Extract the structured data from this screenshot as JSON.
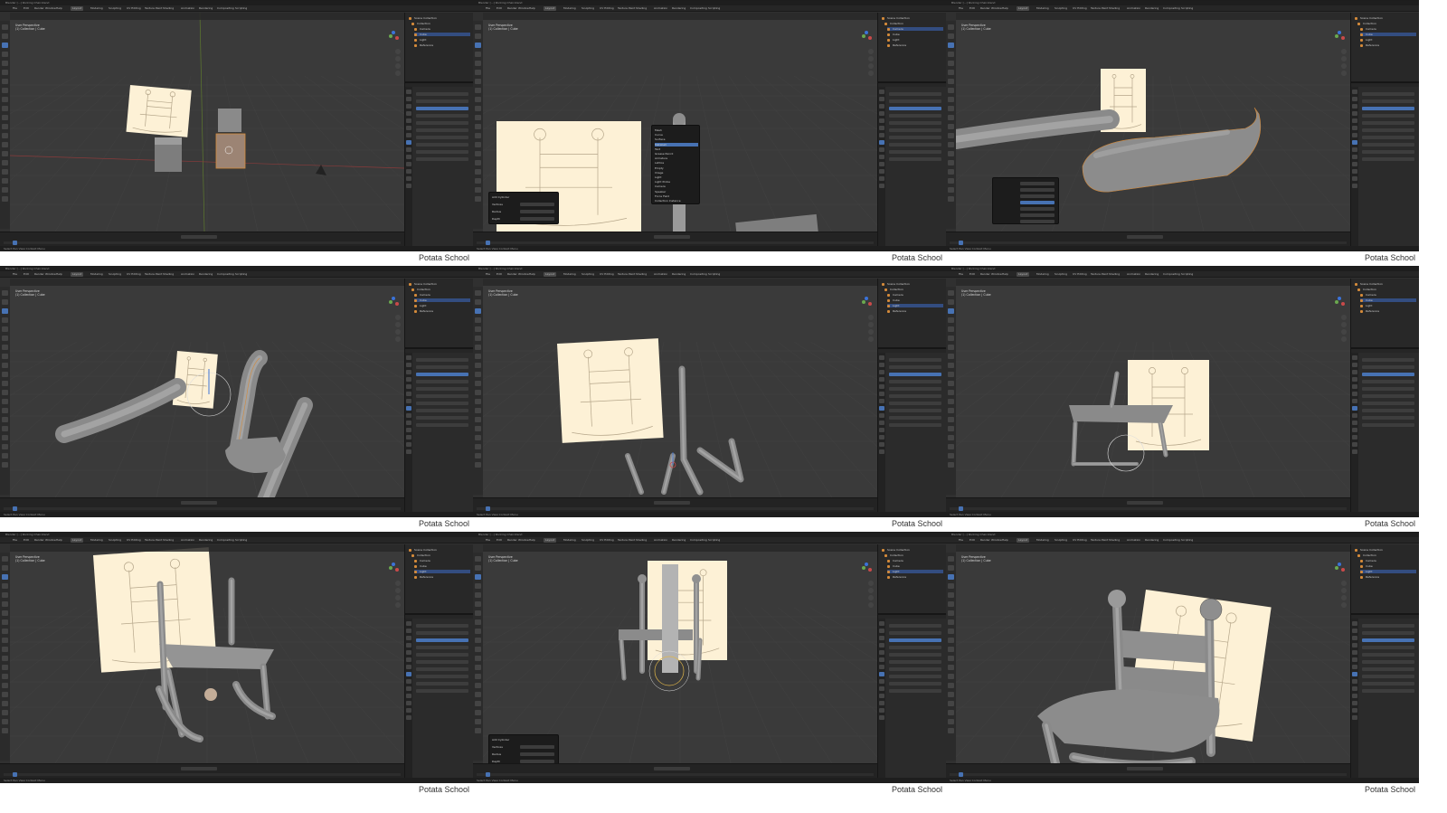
{
  "watermark": "Potata School",
  "app": {
    "title_text": "Blender [...] Rocking Chair.blend",
    "menu": [
      "File",
      "Edit",
      "Render",
      "Window",
      "Help"
    ],
    "workspaces": [
      "Layout",
      "Modeling",
      "Sculpting",
      "UV Editing",
      "Texture Paint",
      "Shading",
      "Animation",
      "Rendering",
      "Compositing",
      "Scripting"
    ],
    "viewport_info": [
      "User Perspective",
      "(1) Collection | Cube"
    ],
    "status_text": "Select  Pan View  Context Menu"
  },
  "outliner_rows": [
    "Scene Collection",
    "Collection",
    "Camera",
    "Cube",
    "Light",
    "Reference"
  ],
  "popups": {
    "add_menu": [
      "Mesh",
      "Curve",
      "Surface",
      "Metaball",
      "Text",
      "Grease Pencil",
      "Armature",
      "Lattice",
      "Empty",
      "Image",
      "Light",
      "Light Probe",
      "Camera",
      "Speaker",
      "Force Field",
      "Collection Instance"
    ],
    "operator_panel_labels": [
      "Add Cylinder",
      "Vertices",
      "Radius",
      "Depth"
    ]
  },
  "colors": {
    "ui_dark": "#303030",
    "accent": "#4772b3",
    "reference_paper": "#fdf1d6",
    "mesh_gray": "#9a9a9a",
    "selected_orange": "#d48a3a"
  },
  "icons": [
    "move-tool-icon",
    "rotate-tool-icon",
    "scale-tool-icon",
    "navigation-gizmo-icon",
    "zoom-icon",
    "hand-pan-icon",
    "camera-view-icon",
    "play-icon"
  ]
}
